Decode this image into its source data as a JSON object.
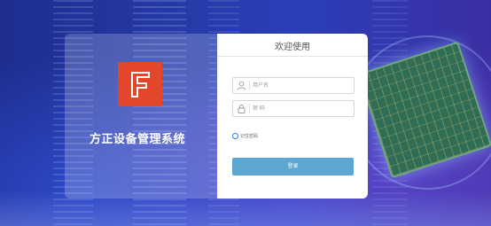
{
  "brand": {
    "system_name": "方正设备管理系统",
    "logo_letter": "F",
    "logo_color": "#e2472b"
  },
  "login": {
    "title": "欢迎使用",
    "username": {
      "placeholder": "用户名",
      "value": "",
      "icon": "user-icon"
    },
    "password": {
      "placeholder": "密 码",
      "value": "",
      "icon": "lock-icon"
    },
    "remember_label": "记住密码",
    "remember_checked": false,
    "submit_label": "登录",
    "submit_color": "#5ba7d1"
  }
}
